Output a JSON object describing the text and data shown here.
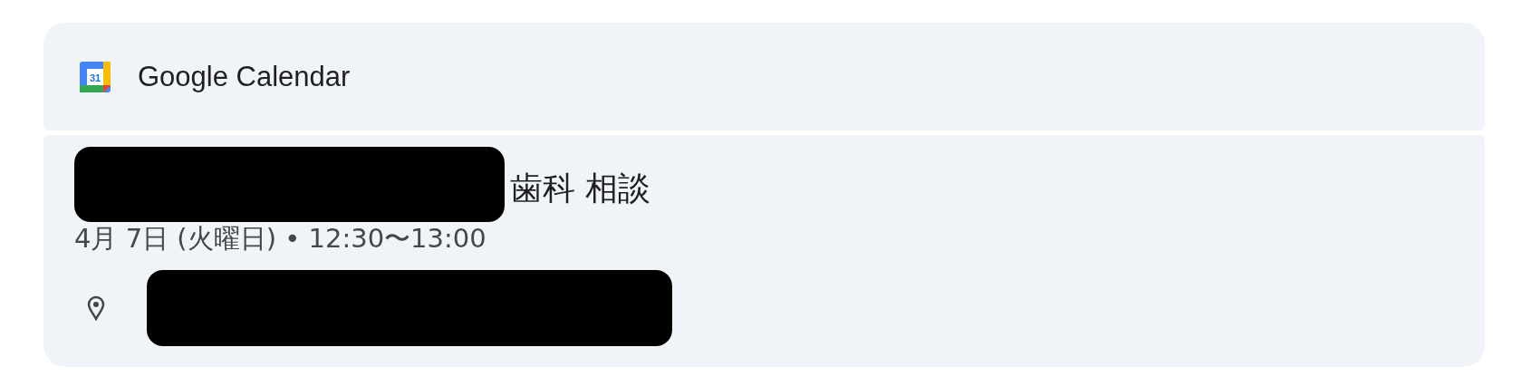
{
  "header": {
    "app_name": "Google Calendar",
    "icon_day": "31"
  },
  "event": {
    "title": "歯科 相談",
    "when": "4月 7日 (火曜日) • 12:30〜13:00"
  }
}
